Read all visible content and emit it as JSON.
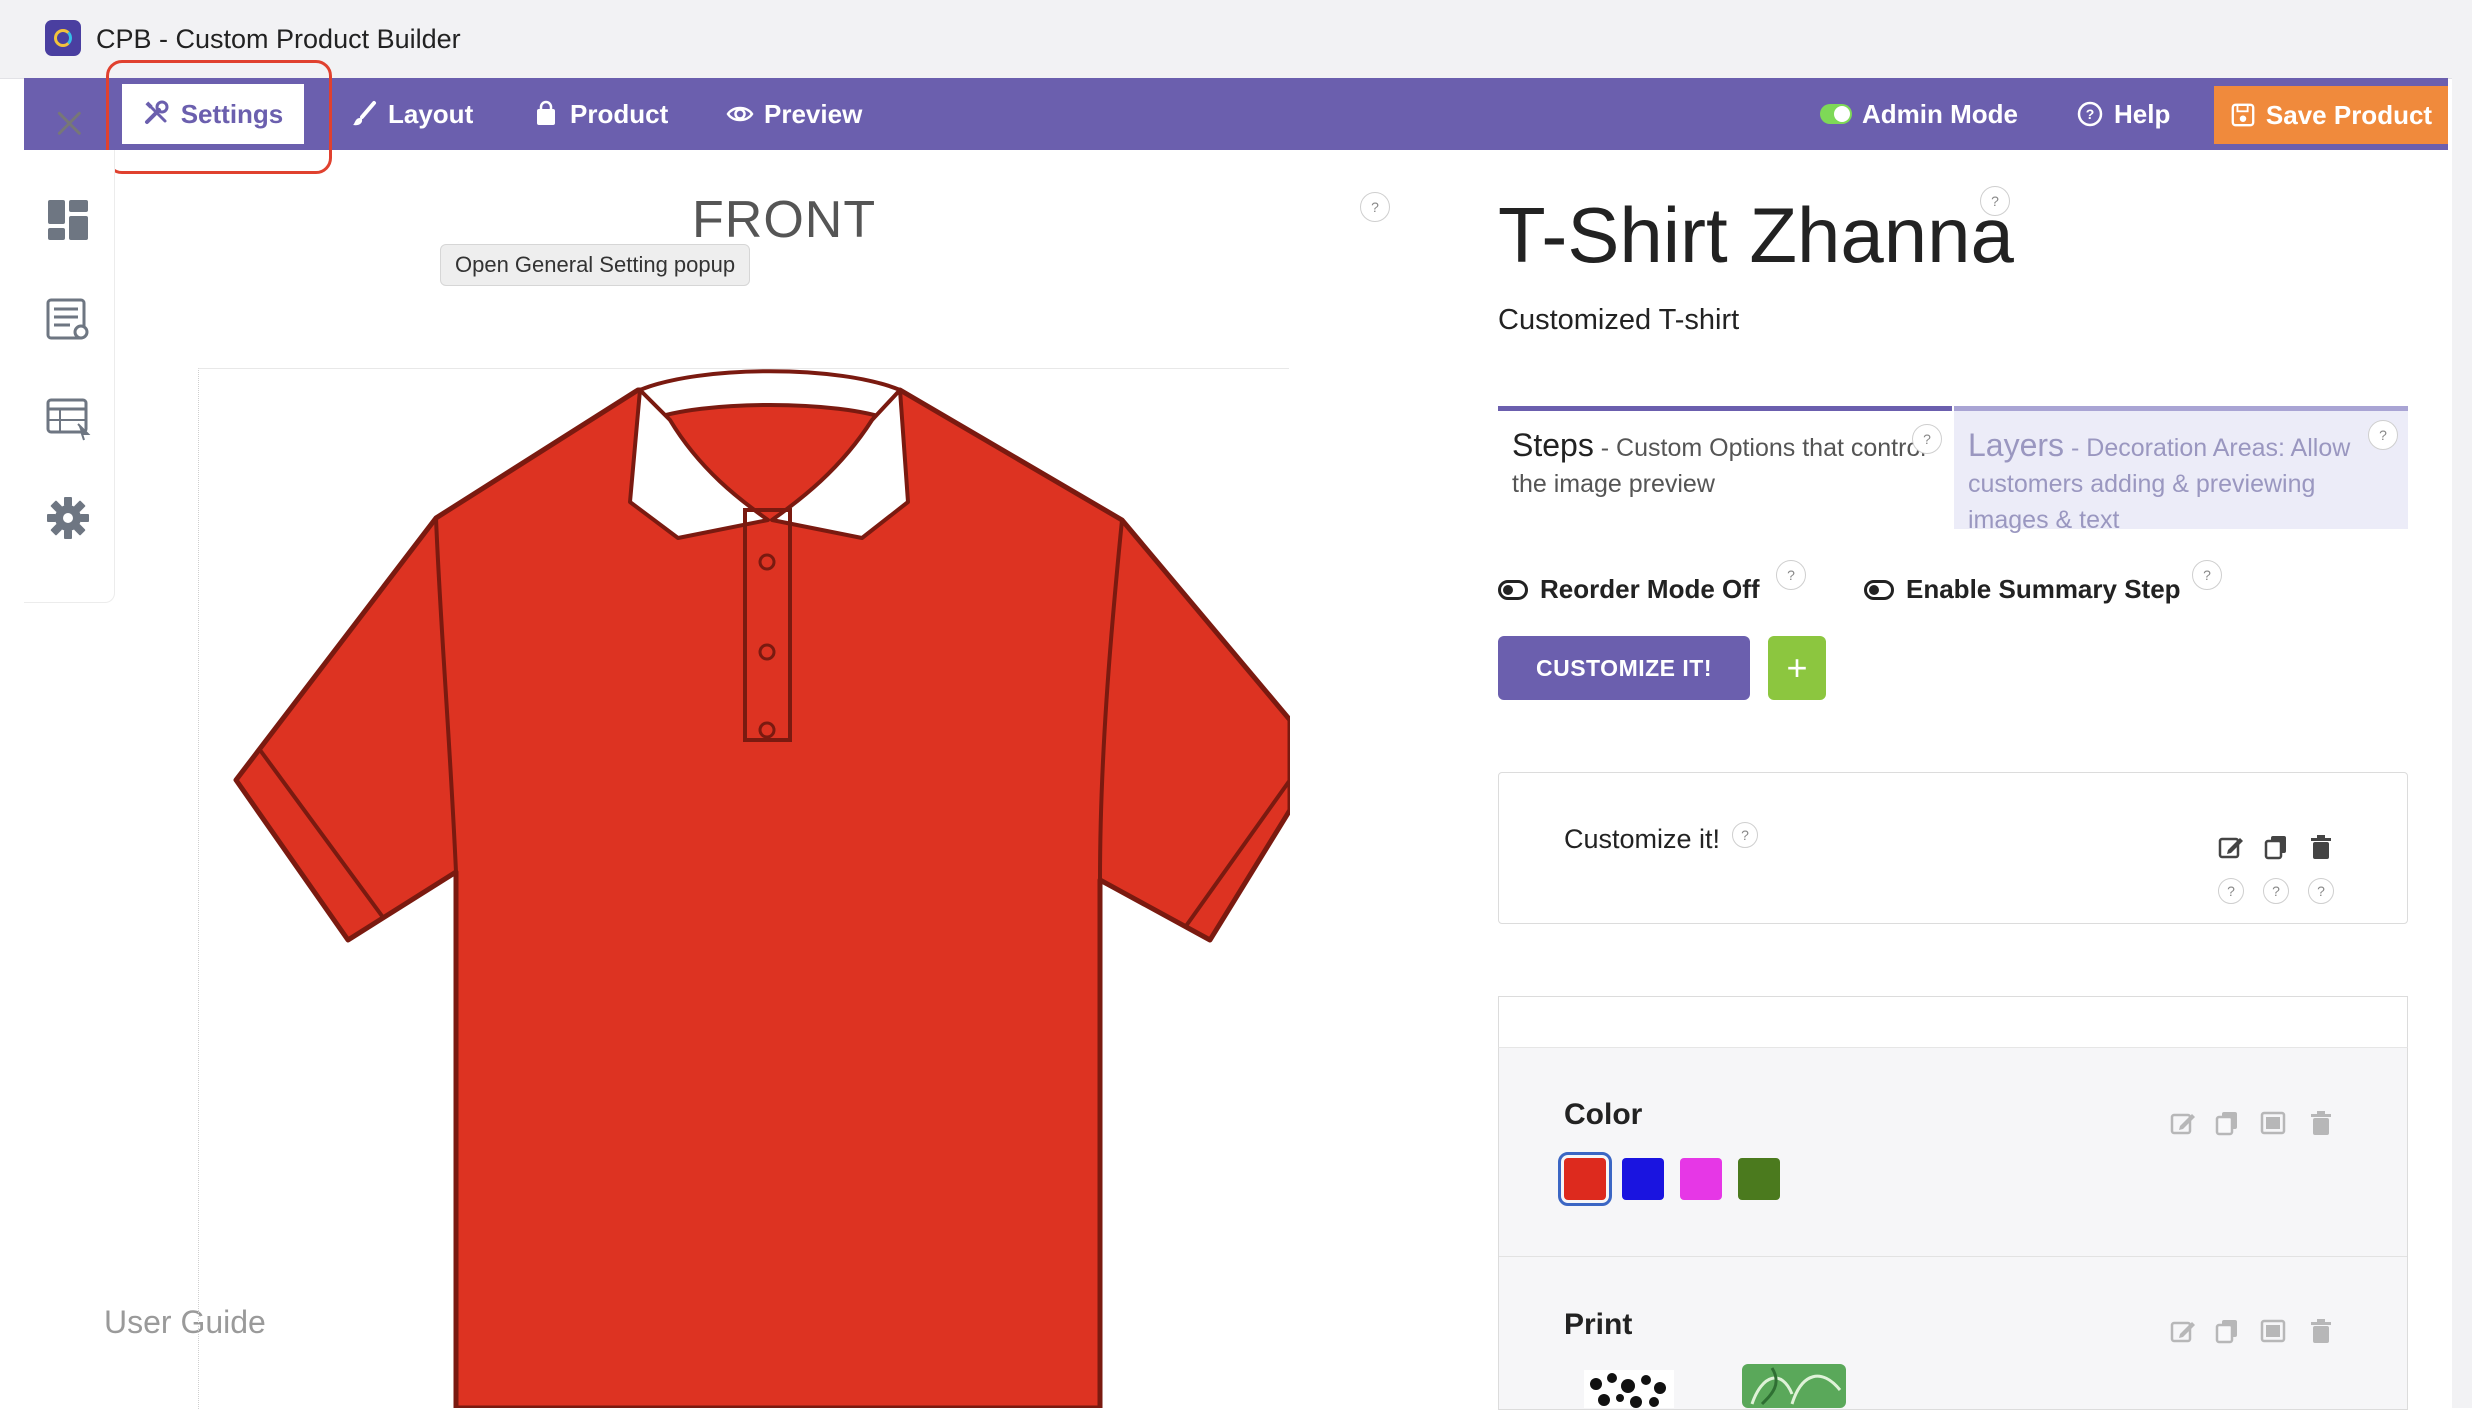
{
  "window": {
    "title": "CPB - Custom Product Builder"
  },
  "toolbar": {
    "settings_label": "Settings",
    "layout_label": "Layout",
    "product_label": "Product",
    "preview_label": "Preview",
    "admin_mode_label": "Admin Mode",
    "help_label": "Help",
    "save_label": "Save Product",
    "accent_color": "#6b5fae",
    "save_color": "#f08a3c"
  },
  "tooltip": {
    "text": "Open General Setting popup"
  },
  "canvas": {
    "view_label": "FRONT",
    "shirt_color": "#dd3322"
  },
  "sidebar": {
    "icons": [
      "dashboard-icon",
      "list-settings-icon",
      "table-settings-icon",
      "gear-icon"
    ],
    "user_guide_label": "User Guide"
  },
  "product": {
    "title": "T-Shirt Zhanna",
    "subtitle": "Customized T-shirt"
  },
  "tabs": {
    "steps": {
      "name": "Steps",
      "desc": " - Custom Options that control the image preview"
    },
    "layers": {
      "name": "Layers",
      "desc": " - Decoration Areas: Allow customers adding & previewing images & text"
    }
  },
  "controls": {
    "reorder_label": "Reorder Mode Off",
    "summary_label": "Enable Summary Step",
    "customize_label": "CUSTOMIZE IT!",
    "add_label": "+"
  },
  "steps": [
    {
      "title": "Customize it!"
    }
  ],
  "options": [
    {
      "title": "Color",
      "swatches": [
        "#dd2a1e",
        "#1a14e0",
        "#e637e6",
        "#4b7a1e"
      ],
      "selected": 0
    },
    {
      "title": "Print"
    }
  ],
  "help_mark": "?"
}
